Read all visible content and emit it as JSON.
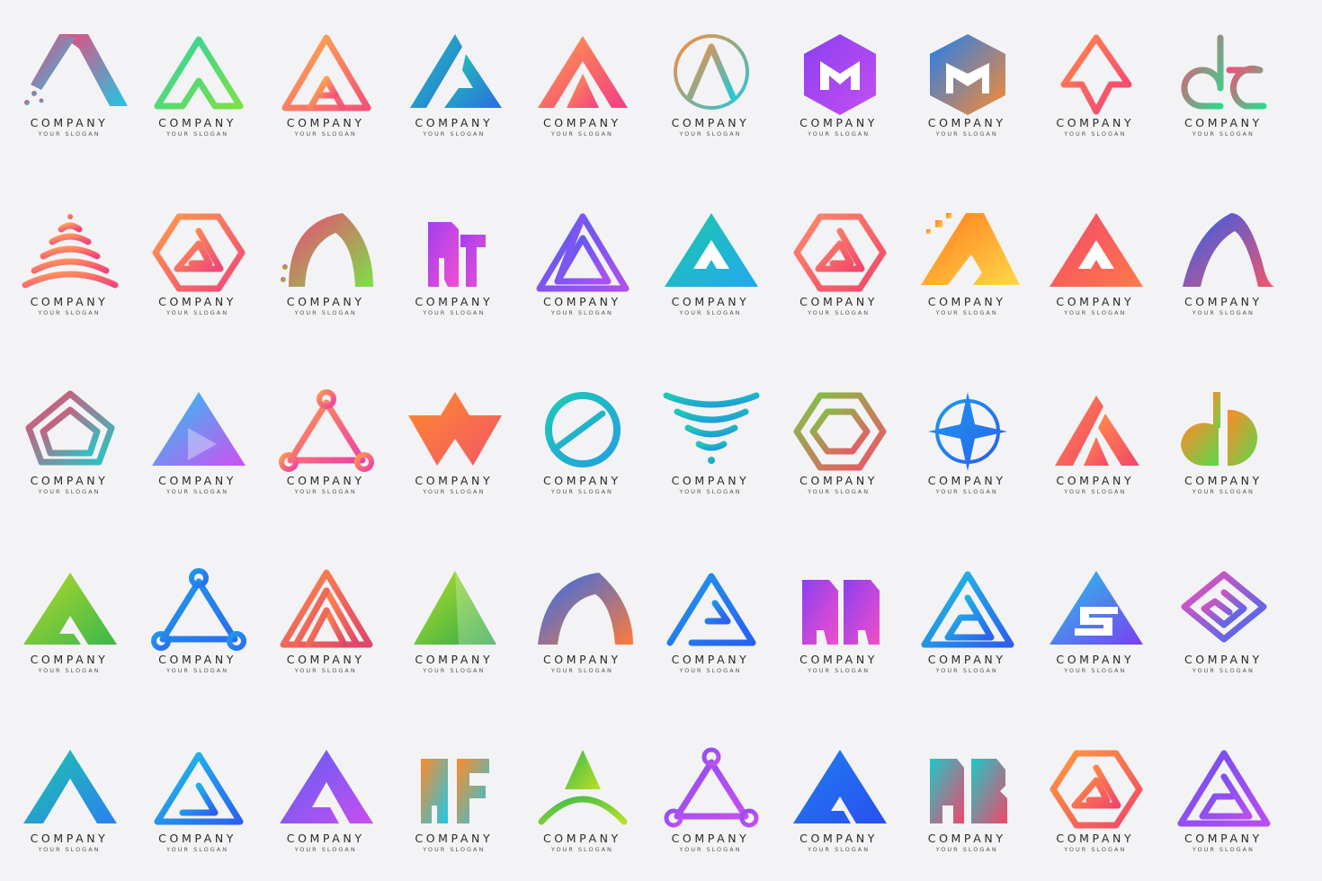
{
  "colors": {
    "background": "#f3f3f5",
    "text": "#2a2a2a"
  },
  "logos": [
    {
      "icon": "swoosh-a-icon",
      "company": "COMPANY",
      "slogan": "YOUR SLOGAN",
      "c1": "#f0467a",
      "c2": "#1ec8e6"
    },
    {
      "icon": "line-a-icon",
      "company": "COMPANY",
      "slogan": "YOUR SLOGAN",
      "c1": "#2ed3a8",
      "c2": "#7be045"
    },
    {
      "icon": "stripe-triangle-icon",
      "company": "COMPANY",
      "slogan": "YOUR SLOGAN",
      "c1": "#ffb347",
      "c2": "#f2517a"
    },
    {
      "icon": "split-a-icon",
      "company": "COMPANY",
      "slogan": "YOUR SLOGAN",
      "c1": "#23c8b2",
      "c2": "#2a6de0"
    },
    {
      "icon": "peak-a-icon",
      "company": "COMPANY",
      "slogan": "YOUR SLOGAN",
      "c1": "#ff9a4a",
      "c2": "#f23f84"
    },
    {
      "icon": "circle-a-icon",
      "company": "COMPANY",
      "slogan": "YOUR SLOGAN",
      "c1": "#ff8a3d",
      "c2": "#22c9d8"
    },
    {
      "icon": "hexagon-m-icon",
      "company": "COMPANY",
      "slogan": "YOUR SLOGAN",
      "c1": "#8b3ff2",
      "c2": "#c44ff0"
    },
    {
      "icon": "cube-m-icon",
      "company": "COMPANY",
      "slogan": "YOUR SLOGAN",
      "c1": "#1e7ff0",
      "c2": "#ff8a2e"
    },
    {
      "icon": "arrow-a-icon",
      "company": "COMPANY",
      "slogan": "YOUR SLOGAN",
      "c1": "#ff8a4a",
      "c2": "#f23f7a"
    },
    {
      "icon": "ae-monogram-icon",
      "company": "COMPANY",
      "slogan": "YOUR SLOGAN",
      "c1": "#f24f7a",
      "c2": "#2fd88a"
    },
    {
      "icon": "wave-pyramid-icon",
      "company": "COMPANY",
      "slogan": "YOUR SLOGAN",
      "c1": "#ff9a5a",
      "c2": "#f0467a"
    },
    {
      "icon": "hexagon-a-icon",
      "company": "COMPANY",
      "slogan": "YOUR SLOGAN",
      "c1": "#ff9a4a",
      "c2": "#f0467a"
    },
    {
      "icon": "arch-a-icon",
      "company": "COMPANY",
      "slogan": "YOUR SLOGAN",
      "c1": "#f0467a",
      "c2": "#7be045"
    },
    {
      "icon": "at-monogram-icon",
      "company": "COMPANY",
      "slogan": "YOUR SLOGAN",
      "c1": "#a23ff2",
      "c2": "#f04fd0"
    },
    {
      "icon": "impossible-triangle-icon",
      "company": "COMPANY",
      "slogan": "YOUR SLOGAN",
      "c1": "#4a5ef2",
      "c2": "#b04ff0"
    },
    {
      "icon": "teal-triangle-icon",
      "company": "COMPANY",
      "slogan": "YOUR SLOGAN",
      "c1": "#1ec8a8",
      "c2": "#23a8f0"
    },
    {
      "icon": "coral-hexagon-icon",
      "company": "COMPANY",
      "slogan": "YOUR SLOGAN",
      "c1": "#ff8a6a",
      "c2": "#f0466a"
    },
    {
      "icon": "pixel-a-icon",
      "company": "COMPANY",
      "slogan": "YOUR SLOGAN",
      "c1": "#ff7a1a",
      "c2": "#ffd84a"
    },
    {
      "icon": "triangle-x-icon",
      "company": "COMPANY",
      "slogan": "YOUR SLOGAN",
      "c1": "#f2466a",
      "c2": "#ff7a4a"
    },
    {
      "icon": "ribbon-a-icon",
      "company": "COMPANY",
      "slogan": "YOUR SLOGAN",
      "c1": "#2a5ff0",
      "c2": "#f2566a"
    },
    {
      "icon": "diamond-outline-icon",
      "company": "COMPANY",
      "slogan": "YOUR SLOGAN",
      "c1": "#f2466a",
      "c2": "#23c8c8"
    },
    {
      "icon": "play-triangle-icon",
      "company": "COMPANY",
      "slogan": "YOUR SLOGAN",
      "c1": "#23c8f0",
      "c2": "#d04ff2"
    },
    {
      "icon": "loop-triangle-icon",
      "company": "COMPANY",
      "slogan": "YOUR SLOGAN",
      "c1": "#ff9a4a",
      "c2": "#f03fa8"
    },
    {
      "icon": "w-chevron-icon",
      "company": "COMPANY",
      "slogan": "YOUR SLOGAN",
      "c1": "#ff8a2a",
      "c2": "#f2566a"
    },
    {
      "icon": "circle-swoosh-icon",
      "company": "COMPANY",
      "slogan": "YOUR SLOGAN",
      "c1": "#1ec8b8",
      "c2": "#23a0e0"
    },
    {
      "icon": "wave-funnel-icon",
      "company": "COMPANY",
      "slogan": "YOUR SLOGAN",
      "c1": "#1ec8b8",
      "c2": "#1e9ad8"
    },
    {
      "icon": "hexagon-spin-icon",
      "company": "COMPANY",
      "slogan": "YOUR SLOGAN",
      "c1": "#7bc845",
      "c2": "#f24f6a"
    },
    {
      "icon": "compass-star-icon",
      "company": "COMPANY",
      "slogan": "YOUR SLOGAN",
      "c1": "#1e9ae8",
      "c2": "#2a5ff0"
    },
    {
      "icon": "stripe-a-icon",
      "company": "COMPANY",
      "slogan": "YOUR SLOGAN",
      "c1": "#ff8a4a",
      "c2": "#f2466a"
    },
    {
      "icon": "ae-leaf-icon",
      "company": "COMPANY",
      "slogan": "YOUR SLOGAN",
      "c1": "#ff8a2a",
      "c2": "#5ad84a"
    },
    {
      "icon": "green-a-icon",
      "company": "COMPANY",
      "slogan": "YOUR SLOGAN",
      "c1": "#b8d82a",
      "c2": "#3ab84a"
    },
    {
      "icon": "blue-loop-triangle-icon",
      "company": "COMPANY",
      "slogan": "YOUR SLOGAN",
      "c1": "#1e9ae8",
      "c2": "#2a6df0"
    },
    {
      "icon": "lined-pyramid-icon",
      "company": "COMPANY",
      "slogan": "YOUR SLOGAN",
      "c1": "#ff8a4a",
      "c2": "#e0466a"
    },
    {
      "icon": "green-peak-icon",
      "company": "COMPANY",
      "slogan": "YOUR SLOGAN",
      "c1": "#b8e02a",
      "c2": "#2aa84a"
    },
    {
      "icon": "arch-wave-icon",
      "company": "COMPANY",
      "slogan": "YOUR SLOGAN",
      "c1": "#2a6df0",
      "c2": "#ff7a3a"
    },
    {
      "icon": "line-ae-icon",
      "company": "COMPANY",
      "slogan": "YOUR SLOGAN",
      "c1": "#1e9ae8",
      "c2": "#2a5ff0"
    },
    {
      "icon": "aa-monogram-icon",
      "company": "COMPANY",
      "slogan": "YOUR SLOGAN",
      "c1": "#8b3ff2",
      "c2": "#f24fc8"
    },
    {
      "icon": "ag-triangle-icon",
      "company": "COMPANY",
      "slogan": "YOUR SLOGAN",
      "c1": "#1ec8e0",
      "c2": "#2a5ff0"
    },
    {
      "icon": "as-triangle-icon",
      "company": "COMPANY",
      "slogan": "YOUR SLOGAN",
      "c1": "#23c8e8",
      "c2": "#7a3ff2"
    },
    {
      "icon": "diamond-g-icon",
      "company": "COMPANY",
      "slogan": "YOUR SLOGAN",
      "c1": "#f24fb8",
      "c2": "#3a6df0"
    },
    {
      "icon": "teal-a-icon",
      "company": "COMPANY",
      "slogan": "YOUR SLOGAN",
      "c1": "#1ec8a8",
      "c2": "#2a7ff0"
    },
    {
      "icon": "blue-a-icon",
      "company": "COMPANY",
      "slogan": "YOUR SLOGAN",
      "c1": "#1ec8e8",
      "c2": "#2a5ff0"
    },
    {
      "icon": "violet-a-icon",
      "company": "COMPANY",
      "slogan": "YOUR SLOGAN",
      "c1": "#5a5ff2",
      "c2": "#c84ff0"
    },
    {
      "icon": "af-monogram-icon",
      "company": "COMPANY",
      "slogan": "YOUR SLOGAN",
      "c1": "#ff8a2a",
      "c2": "#1ec8e8"
    },
    {
      "icon": "arc-a-icon",
      "company": "COMPANY",
      "slogan": "YOUR SLOGAN",
      "c1": "#3ab84a",
      "c2": "#b8e02a"
    },
    {
      "icon": "node-triangle-icon",
      "company": "COMPANY",
      "slogan": "YOUR SLOGAN",
      "c1": "#8b4ff2",
      "c2": "#c84ff0"
    },
    {
      "icon": "bold-a-icon",
      "company": "COMPANY",
      "slogan": "YOUR SLOGAN",
      "c1": "#1e7ff0",
      "c2": "#2a4ff0"
    },
    {
      "icon": "ab-monogram-icon",
      "company": "COMPANY",
      "slogan": "YOUR SLOGAN",
      "c1": "#1ec8c8",
      "c2": "#f2466a"
    },
    {
      "icon": "hexagon-g-icon",
      "company": "COMPANY",
      "slogan": "YOUR SLOGAN",
      "c1": "#ff9a3a",
      "c2": "#f2466a"
    },
    {
      "icon": "purple-triangle-icon",
      "company": "COMPANY",
      "slogan": "YOUR SLOGAN",
      "c1": "#6a4ff2",
      "c2": "#b84ff0"
    }
  ]
}
